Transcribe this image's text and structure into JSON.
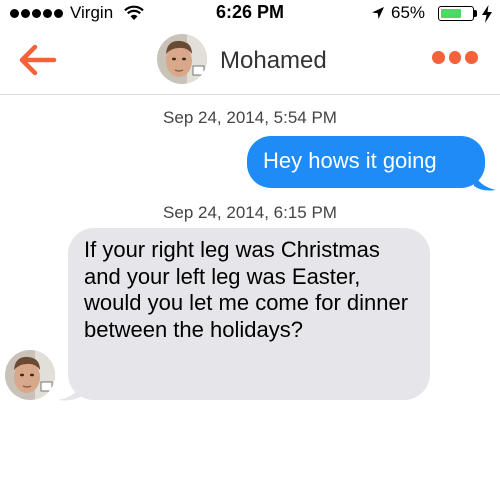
{
  "status_bar": {
    "carrier": "Virgin",
    "time": "6:26 PM",
    "battery_percent": "65%",
    "battery_level": 0.65,
    "signal_bars": 5
  },
  "header": {
    "contact_name": "Mohamed",
    "back_icon": "back-arrow-icon",
    "menu_icon": "more-dots-icon",
    "accent_color": "#f4623a"
  },
  "conversation": {
    "messages": [
      {
        "timestamp": "Sep 24, 2014, 5:54 PM",
        "direction": "outgoing",
        "text": "Hey hows it going",
        "color": "#1e8bf7"
      },
      {
        "timestamp": "Sep 24, 2014, 6:15 PM",
        "direction": "incoming",
        "text": "If your right leg was Christmas and your left leg was Easter, would you let me come for dinner between the holidays?",
        "color": "#e5e5ea"
      }
    ]
  }
}
